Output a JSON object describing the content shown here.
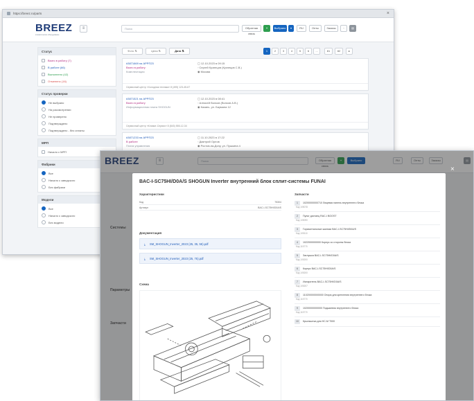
{
  "back_window": {
    "title": "https://breez.ru/parts",
    "close": "×",
    "logo": "BREEZ",
    "logo_sub": "климатическое оборудование",
    "search_placeholder": "Поиск",
    "header_buttons": {
      "feedback": "Обратная связь",
      "plus": "+",
      "selected": "Выбрано",
      "dropdown": "▾",
      "b1": "RU",
      "b2": "Опты",
      "b3": "Заказы"
    },
    "sidebar": {
      "status_title": "Статус",
      "statuses": [
        "Взято в работу (7)",
        "В работе (66)",
        "Выполнено (42)",
        "Отменено (16)"
      ],
      "check_title": "Статус проверки",
      "checks": [
        "Не выбрано",
        "На рассмотрении",
        "Не проверено",
        "Подтверждено",
        "Подтверждено - без оплаты"
      ],
      "mrp_title": "МРП",
      "mrp": [
        "Начало с МРП"
      ],
      "manuf_title": "Фабрики",
      "manuf": [
        "Все",
        "Начало с заводского",
        "Без фабрики"
      ],
      "models_title": "Модели",
      "models": [
        "Все",
        "Начало с заводского",
        "Без модели"
      ]
    },
    "toolbar": {
      "f1": "Фото ⇅",
      "f2": "Цена ⇅",
      "f3": "Дата ⇅",
      "pages": [
        "1",
        "2",
        "3",
        "4",
        "5",
        "6",
        "...",
        "81",
        "82"
      ],
      "next": "▸"
    },
    "cards": [
      {
        "id": "#3871669 на АРРП23",
        "status": "Взято в работу",
        "sub": "Комплектация",
        "date": "12.10.2023 в 09:15",
        "person": "Сергей Кузнецов (Кузнецов С.В.)",
        "location": "Москва",
        "foot": "Сервисный центр «Холодная техника» 8 (495) 123-45-67"
      },
      {
        "id": "#3871521 на АРРП23",
        "status": "Взято в работу",
        "sub": "Информационная плата SHOGUN",
        "date": "12.10.2023 в 08:41",
        "person": "Алексей Волков (Волков А.В.)",
        "location": "Казань, ул. Баумана 12",
        "foot": "Сервисный центр «Климат-Сервис» 8 (843) 555-12-34"
      },
      {
        "id": "#3871233 на АРРП23",
        "status": "В работе",
        "sub": "Плата управления",
        "date": "11.10.2023 в 17:22",
        "person": "Дмитрий Орлов",
        "location": "Ростов-на-Дону, ул. Пушкина 4",
        "foot": ""
      }
    ]
  },
  "front_window": {
    "logo": "BREEZ",
    "search_placeholder": "Поиск",
    "feedback": "Обратная связь",
    "plus": "+",
    "selected": "Выбрано",
    "b1": "RU",
    "b2": "Опты",
    "b3": "Заказы",
    "bg_labels": [
      "Системы",
      "Параметры",
      "Запчасти"
    ],
    "modal": {
      "title": "BAC-I-SC75HI/D0A/S SHOGUN Inverter внутренний блок сплит-системы FUNAI",
      "close": "×",
      "specs_title": "Характеристики",
      "specs": [
        {
          "k": "Код",
          "v": "75304"
        },
        {
          "k": "Артикул",
          "v": "BAC-I-SC75HI/D0A/S"
        }
      ],
      "docs_title": "Документация",
      "docs": [
        "SM_SHOGUN_Inverter_2023 (25, 35, 55).pdf",
        "SM_SHOGUN_Inverter_2023 (25, 75).pdf"
      ],
      "scheme_title": "Схема",
      "parts_title": "Запчасти",
      "parts": [
        {
          "n": "1",
          "name": "10200000000710 Лицевая панель внутреннего блока",
          "code": "Код 105078"
        },
        {
          "n": "2",
          "name": "Пульт дистанц RAC-I BOOST",
          "code": "Код 105090"
        },
        {
          "n": "3",
          "name": "Горизонтальные жалюзи BAC-I-SC75HI/D0A/S",
          "code": "Код 105110"
        },
        {
          "n": "4",
          "name": "1022000000000 Корпус со стороны блока",
          "code": "Код 115770"
        },
        {
          "n": "5",
          "name": "Заглушка BAC-I-SC75HI/D0A/S",
          "code": "Код 105200"
        },
        {
          "n": "6",
          "name": "Корпус BAC-I-SC75HI/D0A/S",
          "code": "Код 105200"
        },
        {
          "n": "7",
          "name": "Испаритель BAC-I-SC75HI/D0A/S",
          "code": "Код 105207"
        },
        {
          "n": "8",
          "name": "110200000000000 Опора для крепления внутреннего блока",
          "code": "Код 115770"
        },
        {
          "n": "9",
          "name": "10200000000000 Подшипник внутреннего блока",
          "code": "Код 115770"
        },
        {
          "n": "10",
          "name": "Крыльчатка для HC-M T000",
          "code": ""
        }
      ]
    }
  },
  "colors": {
    "brand": "#1f3c78",
    "accent": "#1565c0",
    "status": "#b0267f",
    "green": "#2e9e4f"
  }
}
